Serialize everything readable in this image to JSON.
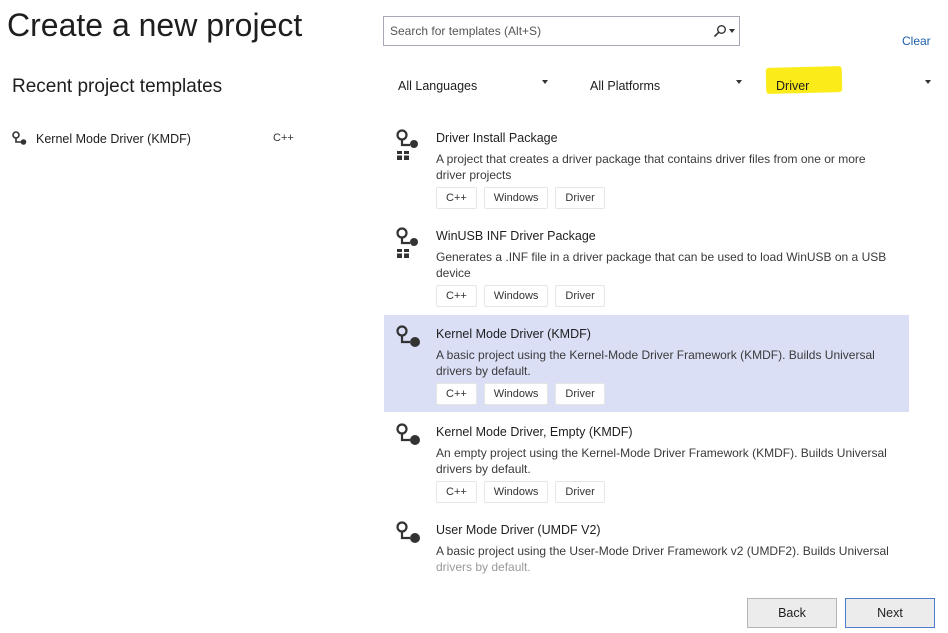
{
  "header": {
    "title": "Create a new project",
    "recent_title": "Recent project templates",
    "clear_label": "Clear"
  },
  "search": {
    "placeholder": "Search for templates (Alt+S)"
  },
  "filters": {
    "language": "All Languages",
    "platform": "All Platforms",
    "project_type": "Driver"
  },
  "recent": [
    {
      "label": "Kernel Mode Driver (KMDF)",
      "tag": "C++",
      "icon": "driver-icon"
    }
  ],
  "templates": [
    {
      "title": "Driver Install Package",
      "description": "A project that creates a driver package that contains driver files from one or more driver projects",
      "tags": [
        "C++",
        "Windows",
        "Driver"
      ],
      "icon": "driver-package-icon",
      "selected": false
    },
    {
      "title": "WinUSB INF Driver Package",
      "description": "Generates a .INF file in a driver package that can be used to load WinUSB on a USB device",
      "tags": [
        "C++",
        "Windows",
        "Driver"
      ],
      "icon": "driver-package-icon",
      "selected": false
    },
    {
      "title": "Kernel Mode Driver (KMDF)",
      "description": "A basic project using the Kernel-Mode Driver Framework (KMDF). Builds Universal drivers by default.",
      "tags": [
        "C++",
        "Windows",
        "Driver"
      ],
      "icon": "driver-icon",
      "selected": true
    },
    {
      "title": "Kernel Mode Driver, Empty (KMDF)",
      "description": "An empty project using the Kernel-Mode Driver Framework (KMDF). Builds Universal drivers by default.",
      "tags": [
        "C++",
        "Windows",
        "Driver"
      ],
      "icon": "driver-icon",
      "selected": false
    },
    {
      "title": "User Mode Driver (UMDF V2)",
      "description_line1": "A basic project using the User-Mode Driver Framework v2 (UMDF2). Builds Universal",
      "description_line2": "drivers by default.",
      "icon": "driver-icon",
      "selected": false
    }
  ],
  "buttons": {
    "back": "Back",
    "next": "Next"
  },
  "colors": {
    "selected_row": "#dadff6",
    "highlight": "#fbec19",
    "link": "#1d5ea8",
    "next_border": "#4f7ccf"
  }
}
